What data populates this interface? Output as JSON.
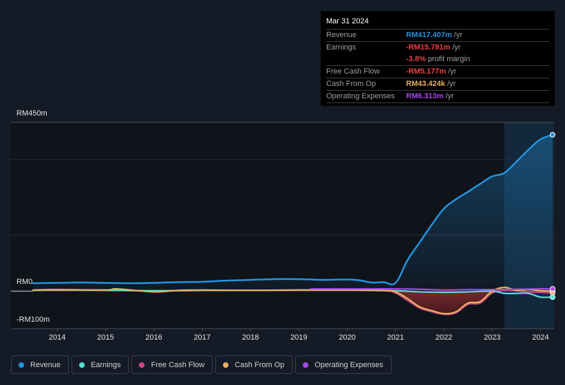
{
  "tooltip": {
    "date": "Mar 31 2024",
    "rows": [
      {
        "label": "Revenue",
        "value": "RM417.407m",
        "unit": "/yr",
        "color": "#2394df"
      },
      {
        "label": "Earnings",
        "value": "-RM15.781m",
        "unit": "/yr",
        "color": "#e64545"
      },
      {
        "label": "",
        "value": "-3.8%",
        "unit": "profit margin",
        "color": "#e64545"
      },
      {
        "label": "Free Cash Flow",
        "value": "-RM5.177m",
        "unit": "/yr",
        "color": "#e64545"
      },
      {
        "label": "Cash From Op",
        "value": "RM43.424k",
        "unit": "/yr",
        "color": "#e8b15f"
      },
      {
        "label": "Operating Expenses",
        "value": "RM6.313m",
        "unit": "/yr",
        "color": "#a34be8"
      }
    ]
  },
  "chart_data": {
    "type": "line",
    "title": "",
    "xlabel": "",
    "ylabel": "",
    "y_ticks": [
      "RM450m",
      "RM0",
      "-RM100m"
    ],
    "ylim": [
      -100,
      450
    ],
    "x_ticks": [
      "2014",
      "2015",
      "2016",
      "2017",
      "2018",
      "2019",
      "2020",
      "2021",
      "2022",
      "2023",
      "2024"
    ],
    "xlim": [
      2013.5,
      2024.25
    ],
    "forecast_shade_start": 2023.25,
    "units": "RM millions",
    "series": [
      {
        "name": "Revenue",
        "color": "#2394df",
        "x": [
          2013.5,
          2014.0,
          2014.5,
          2015.0,
          2015.5,
          2016.0,
          2016.5,
          2017.0,
          2017.5,
          2018.0,
          2018.5,
          2019.0,
          2019.5,
          2020.0,
          2020.25,
          2020.5,
          2020.75,
          2021.0,
          2021.25,
          2021.5,
          2021.75,
          2022.0,
          2022.25,
          2022.5,
          2022.75,
          2023.0,
          2023.25,
          2023.5,
          2023.75,
          2024.0,
          2024.25
        ],
        "values": [
          21,
          22,
          23,
          22,
          21,
          22,
          24,
          25,
          28,
          30,
          32,
          32,
          30,
          31,
          29,
          23,
          24,
          22,
          83,
          130,
          177,
          220,
          245,
          265,
          286,
          306,
          315,
          345,
          377,
          405,
          417
        ]
      },
      {
        "name": "Earnings",
        "color": "#58e0cf",
        "x": [
          2013.5,
          2014.0,
          2015.0,
          2016.0,
          2017.0,
          2018.0,
          2019.0,
          2020.0,
          2021.0,
          2021.5,
          2022.0,
          2022.5,
          2023.0,
          2023.25,
          2023.5,
          2023.75,
          2024.0,
          2024.25
        ],
        "values": [
          2,
          3,
          2,
          1,
          2,
          2,
          3,
          3,
          1,
          -2,
          -3,
          -2,
          0,
          -6,
          -6,
          -6,
          -16,
          -16
        ]
      },
      {
        "name": "Free Cash Flow",
        "color": "#d0468a",
        "x": [
          2013.5,
          2014.0,
          2015.0,
          2016.0,
          2017.0,
          2018.0,
          2019.0,
          2020.0,
          2020.75,
          2021.0,
          2021.25,
          2021.5,
          2021.75,
          2022.0,
          2022.25,
          2022.5,
          2022.75,
          2023.0,
          2023.25,
          2023.5,
          2023.75,
          2024.0,
          2024.25
        ],
        "values": [
          2,
          2,
          3,
          0,
          2,
          2,
          2,
          2,
          1,
          -5,
          -25,
          -45,
          -55,
          -62,
          -58,
          -35,
          -32,
          -5,
          2,
          1,
          -2,
          -3,
          -5
        ]
      },
      {
        "name": "Cash From Op",
        "color": "#e8b15f",
        "x": [
          2013.5,
          2014.0,
          2015.0,
          2015.25,
          2016.0,
          2016.5,
          2017.0,
          2018.0,
          2019.0,
          2020.0,
          2020.75,
          2021.0,
          2021.25,
          2021.5,
          2021.75,
          2022.0,
          2022.25,
          2022.5,
          2022.75,
          2023.0,
          2023.25,
          2023.5,
          2023.75,
          2024.0,
          2024.25
        ],
        "values": [
          3,
          4,
          3,
          6,
          -2,
          2,
          3,
          2,
          3,
          3,
          2,
          -2,
          -20,
          -42,
          -52,
          -60,
          -55,
          -32,
          -28,
          0,
          10,
          2,
          4,
          1,
          0
        ]
      },
      {
        "name": "Operating Expenses",
        "color": "#a34be8",
        "x": [
          2019.25,
          2020.0,
          2020.5,
          2021.0,
          2021.5,
          2022.0,
          2022.5,
          2023.0,
          2023.5,
          2024.0,
          2024.25
        ],
        "values": [
          6,
          6,
          6,
          6,
          5,
          3,
          4,
          4,
          5,
          6,
          6
        ]
      }
    ],
    "legend": [
      "Revenue",
      "Earnings",
      "Free Cash Flow",
      "Cash From Op",
      "Operating Expenses"
    ],
    "legend_position": "bottom-left",
    "grid": true
  }
}
